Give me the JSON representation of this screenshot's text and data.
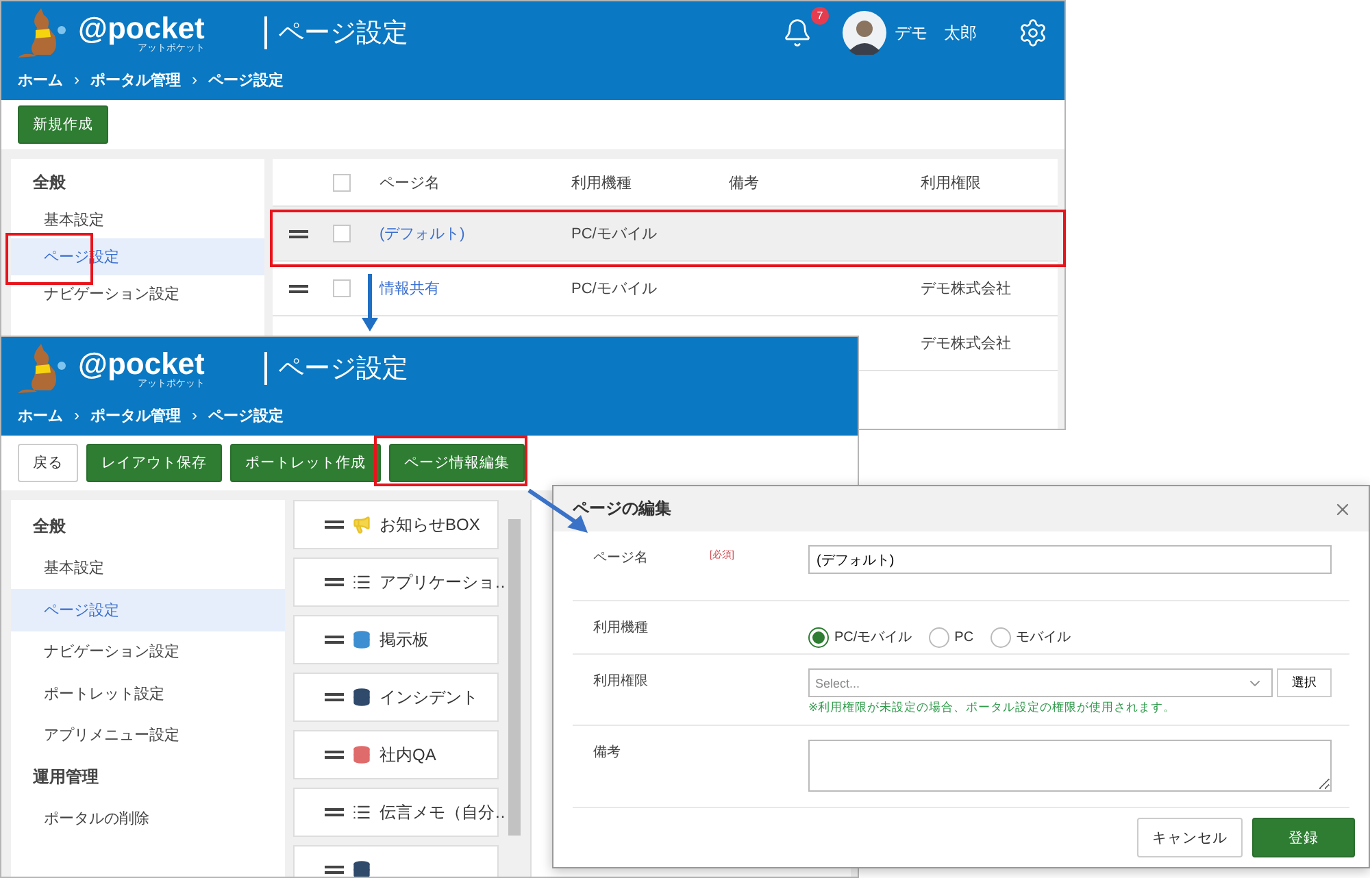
{
  "list_screen": {
    "header": {
      "logo": "@pocket",
      "logo_sub": "アットポケット",
      "title": "ページ設定",
      "notifications": "7",
      "user": "デモ　太郎",
      "breadcrumb": [
        {
          "text": "ホーム",
          "kind": "link"
        },
        {
          "text": "›",
          "kind": "separator"
        },
        {
          "text": "ポータル管理",
          "kind": "link"
        },
        {
          "text": "›",
          "kind": "separator"
        },
        {
          "text": "ページ設定",
          "kind": "link"
        }
      ]
    },
    "toolbar": [
      {
        "label": "新規作成",
        "kind": "primary"
      }
    ],
    "sidebar": [
      {
        "label": "全般",
        "kind": "heading",
        "selected": false
      },
      {
        "label": "基本設定",
        "kind": "item",
        "selected": false
      },
      {
        "label": "ページ設定",
        "kind": "item",
        "selected": true
      },
      {
        "label": "ナビゲーション設定",
        "kind": "item",
        "selected": false
      }
    ],
    "table": {
      "all_checked": false,
      "columns": [
        "ページ名",
        "利用機種",
        "備考",
        "利用権限"
      ],
      "rows": [
        {
          "name": "(デフォルト)",
          "device": "PC/モバイル",
          "highlighted": true,
          "checked": false
        },
        {
          "name": "情報共有",
          "device": "PC/モバイル",
          "permission": "デモ株式会社",
          "highlighted": false,
          "checked": false
        },
        {
          "permission": "デモ株式会社"
        }
      ]
    }
  },
  "edit_screen": {
    "header": {
      "logo": "@pocket",
      "logo_sub": "アットポケット",
      "title": "ページ設定",
      "breadcrumb": [
        {
          "text": "ホーム",
          "kind": "link"
        },
        {
          "text": "›",
          "kind": "separator"
        },
        {
          "text": "ポータル管理",
          "kind": "link"
        },
        {
          "text": "›",
          "kind": "separator"
        },
        {
          "text": "ページ設定",
          "kind": "link"
        }
      ]
    },
    "toolbar": [
      {
        "label": "戻る",
        "kind": "secondary"
      },
      {
        "label": "レイアウト保存",
        "kind": "primary"
      },
      {
        "label": "ポートレット作成",
        "kind": "primary"
      },
      {
        "label": "ページ情報編集",
        "kind": "primary"
      }
    ],
    "sidebar": [
      {
        "label": "全般",
        "kind": "heading",
        "selected": false
      },
      {
        "label": "基本設定",
        "kind": "item",
        "selected": false
      },
      {
        "label": "ページ設定",
        "kind": "item",
        "selected": true
      },
      {
        "label": "ナビゲーション設定",
        "kind": "item",
        "selected": false
      },
      {
        "label": "ポートレット設定",
        "kind": "item",
        "selected": false
      },
      {
        "label": "アプリメニュー設定",
        "kind": "item",
        "selected": false
      },
      {
        "label": "運用管理",
        "kind": "heading",
        "selected": false
      },
      {
        "label": "ポータルの削除",
        "kind": "item",
        "selected": false
      }
    ],
    "portlets": [
      {
        "label": "お知らせBOX",
        "kind": "announcement"
      },
      {
        "label": "アプリケーショ…",
        "kind": "list"
      },
      {
        "label": "掲示板",
        "kind": "database",
        "color": "#3d8fd1"
      },
      {
        "label": "インシデント",
        "kind": "database",
        "color": "#2f4a6b"
      },
      {
        "label": "社内QA",
        "kind": "database",
        "color": "#e06b6b"
      },
      {
        "label": "伝言メモ（自分…",
        "kind": "list"
      },
      {
        "kind": "database",
        "color": "#2f4a6b"
      }
    ]
  },
  "dialog": {
    "title": "ページの編集",
    "fields": [
      {
        "kind": "text",
        "label": "ページ名",
        "required": "[必須]",
        "value": "(デフォルト)"
      },
      {
        "kind": "radio",
        "label": "利用機種",
        "options": [
          {
            "label": "PC/モバイル",
            "selected": true
          },
          {
            "label": "PC",
            "selected": false
          },
          {
            "label": "モバイル",
            "selected": false
          }
        ]
      },
      {
        "kind": "select",
        "label": "利用権限",
        "placeholder": "Select...",
        "button": "選択",
        "help": "※利用権限が未設定の場合、ポータル設定の権限が使用されます。"
      },
      {
        "kind": "textarea",
        "label": "備考"
      }
    ],
    "buttons": [
      {
        "label": "キャンセル",
        "kind": "secondary"
      },
      {
        "label": "登録",
        "kind": "primary"
      }
    ]
  }
}
